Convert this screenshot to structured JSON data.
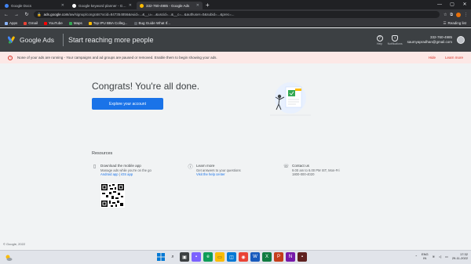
{
  "browser": {
    "tabs": [
      {
        "title": "Google Docs",
        "active": false
      },
      {
        "title": "Google keyword planner - Goog",
        "active": false
      },
      {
        "title": "332-760-4985 - Google Ads",
        "active": true
      }
    ],
    "url_domain": "ads.google.com",
    "url_rest": "/aw/signup/congrats?ocid=847354856&euid=...&__u=...&uscid=...&__c=...&authuser=0&subid=...&prec=...",
    "bookmarks": [
      "Apps",
      "Gmail",
      "YouTube",
      "Maps",
      "Top IPU BBA Colleg...",
      "Bug Guide What If..."
    ],
    "reading_list": "Reading list"
  },
  "ads_header": {
    "logo": "Google Ads",
    "title": "Start reaching more people",
    "help_label": "Help",
    "notifications_label": "Notifications",
    "account_id": "332-760-4985",
    "account_email": "saumyapradhan@gmail.com"
  },
  "alert": {
    "bold": "None of your ads are running",
    "text": " - Your campaigns and ad groups are paused or removed. Enable them to begin showing your ads.",
    "hide": "Hide",
    "learn_more": "Learn more"
  },
  "main": {
    "congrats": "Congrats! You're all done.",
    "explore_button": "Explore your account",
    "resources_title": "Resources"
  },
  "resources": [
    {
      "title": "Download the mobile app",
      "line1": "Manage ads while you're on the go",
      "link1": "Android app",
      "sep": " | ",
      "link2": "iOS app"
    },
    {
      "title": "Learn more",
      "line1": "Get answers to your questions",
      "link1": "Visit the help center"
    },
    {
      "title": "Contact us",
      "line1": "9.00 am to 6.00 PM IST, Mon-Fri",
      "line2": "1800-000-4020"
    }
  ],
  "footer": "© Google, 2022",
  "taskbar": {
    "lang_top": "ENG",
    "lang_bottom": "IN",
    "time": "17:32",
    "date": "29-11-2022"
  },
  "colors": {
    "header_bg": "#3c4043",
    "alert_bg": "#fce8e6",
    "primary": "#1a73e8",
    "danger": "#d93025"
  }
}
